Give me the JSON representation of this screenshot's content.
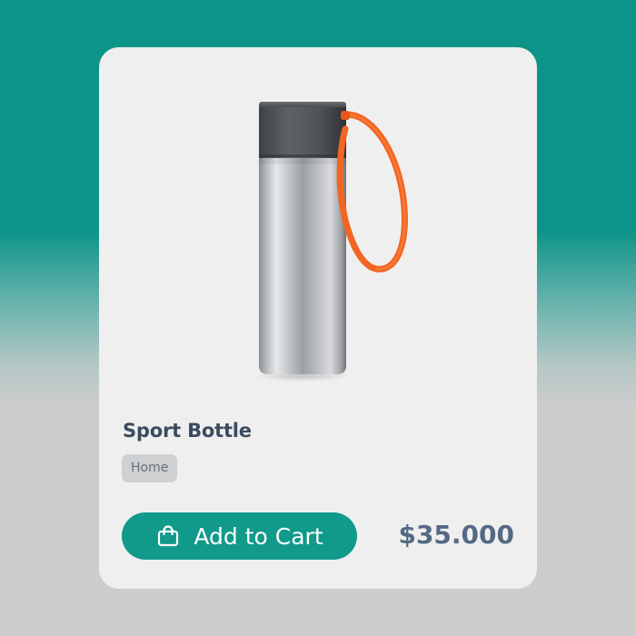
{
  "product": {
    "title": "Sport Bottle",
    "category": "Home",
    "price": "$35.000",
    "image_icon": "stainless-steel-travel-bottle"
  },
  "actions": {
    "add_to_cart_label": "Add to Cart",
    "add_to_cart_icon": "shopping-bag-icon"
  },
  "colors": {
    "page_top": "#0d9488",
    "page_bottom": "#cdcdcd",
    "card_background": "#efefef",
    "accent": "#11998a",
    "strap": "#f26522",
    "title_text": "#3b4b5f",
    "price_text": "#546a83"
  }
}
